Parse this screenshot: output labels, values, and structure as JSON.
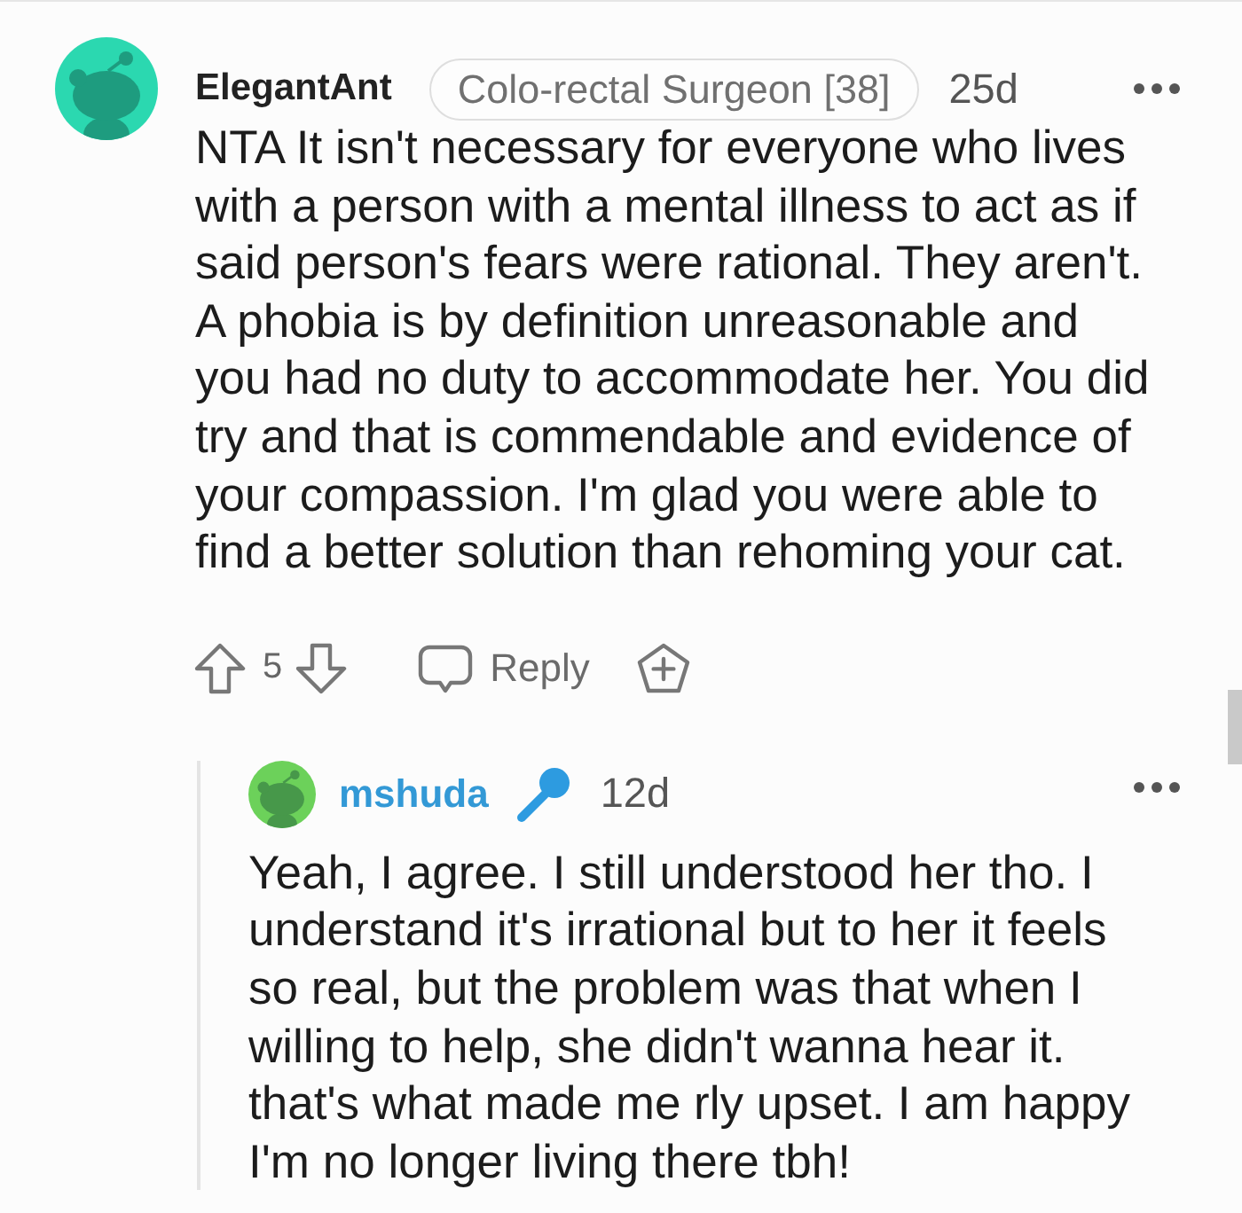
{
  "thread": [
    {
      "author": "ElegantAnt",
      "op": false,
      "color": "#2bd8b0",
      "flair": "Colo-rectal Surgeon [38]",
      "age": "25d",
      "body": "NTA It isn't necessary for everyone who lives with a person with a mental illness to act as if said person's fears were rational. They aren't. A phobia is by definition unreasonable and you had no duty to accommodate her. You did try and that is commendable and evidence of your compassion. I'm glad you were able to find a better solution than rehoming your cat.",
      "score": "5",
      "reply_label": "Reply",
      "replies": [
        {
          "author": "mshuda",
          "op": true,
          "color": "#6cd15a",
          "age": "12d",
          "body": "Yeah, I agree. I still understood her tho. I understand it's irrational but to her it feels so real, but the problem was that when I willing to help, she didn't wanna hear it. that's what made me rly upset. I am happy I'm no longer living there tbh!"
        }
      ]
    }
  ]
}
